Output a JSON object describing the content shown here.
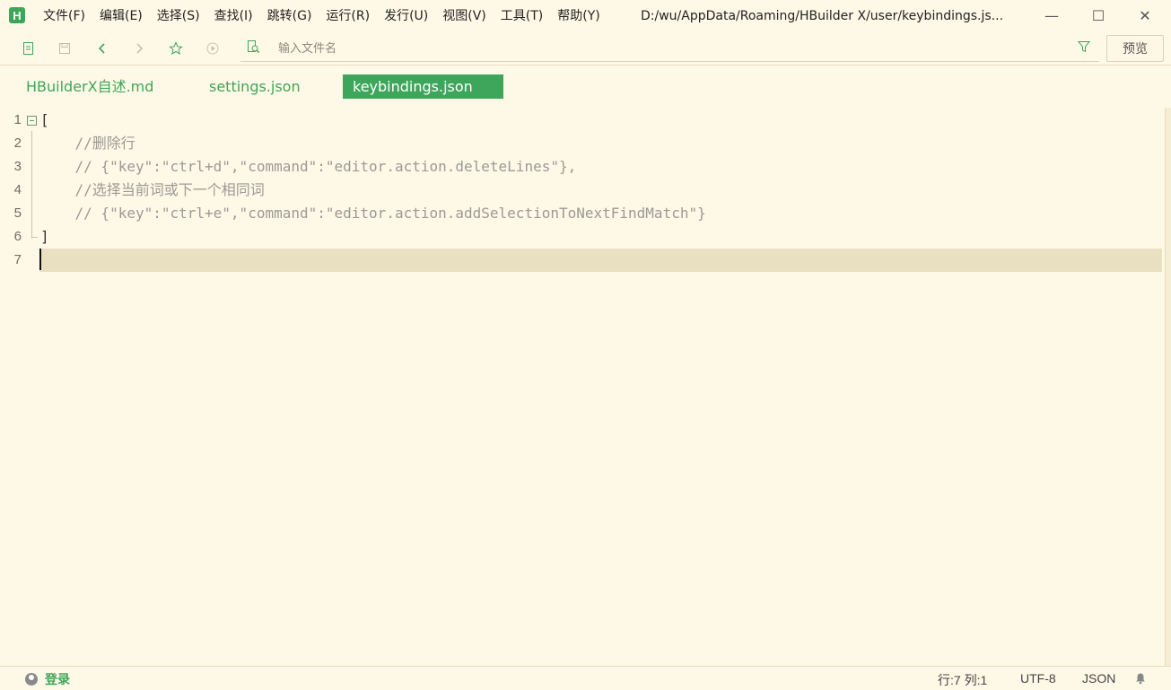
{
  "app": {
    "logo_letter": "H",
    "title_path": "D:/wu/AppData/Roaming/HBuilder X/user/keybindings.js..."
  },
  "menu": [
    {
      "label": "文件(F)"
    },
    {
      "label": "编辑(E)"
    },
    {
      "label": "选择(S)"
    },
    {
      "label": "查找(I)"
    },
    {
      "label": "跳转(G)"
    },
    {
      "label": "运行(R)"
    },
    {
      "label": "发行(U)"
    },
    {
      "label": "视图(V)"
    },
    {
      "label": "工具(T)"
    },
    {
      "label": "帮助(Y)"
    }
  ],
  "window_controls": {
    "minimize": "—",
    "maximize": "☐",
    "close": "✕"
  },
  "toolbar": {
    "search_placeholder": "输入文件名",
    "preview_label": "预览"
  },
  "tabs": [
    {
      "label": "HBuilderX自述.md",
      "active": false
    },
    {
      "label": "settings.json",
      "active": false
    },
    {
      "label": "keybindings.json",
      "active": true
    }
  ],
  "editor": {
    "lines": [
      {
        "num": "1",
        "text": "["
      },
      {
        "num": "2",
        "text": "    //删除行"
      },
      {
        "num": "3",
        "text": "    // {\"key\":\"ctrl+d\",\"command\":\"editor.action.deleteLines\"},"
      },
      {
        "num": "4",
        "text": "    //选择当前词或下一个相同词"
      },
      {
        "num": "5",
        "text": "    // {\"key\":\"ctrl+e\",\"command\":\"editor.action.addSelectionToNextFindMatch\"}"
      },
      {
        "num": "6",
        "text": "]"
      },
      {
        "num": "7",
        "text": ""
      }
    ]
  },
  "status": {
    "login_label": "登录",
    "position": "行:7  列:1",
    "encoding": "UTF-8",
    "language": "JSON"
  },
  "colors": {
    "accent": "#3ea65a",
    "background": "#fef8e6",
    "current_line": "#e9dfc1",
    "comment": "#9b9a95"
  }
}
